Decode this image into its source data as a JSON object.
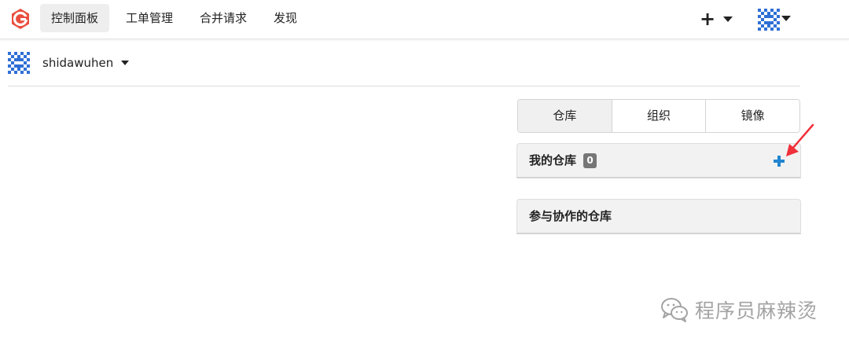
{
  "nav": {
    "items": [
      {
        "label": "控制面板",
        "active": true
      },
      {
        "label": "工单管理",
        "active": false
      },
      {
        "label": "合并请求",
        "active": false
      },
      {
        "label": "发现",
        "active": false
      }
    ],
    "create_icon": "plus-icon",
    "user_avatar": "identicon-avatar"
  },
  "context": {
    "username": "shidawuhen"
  },
  "tabs": [
    {
      "label": "仓库",
      "active": true
    },
    {
      "label": "组织",
      "active": false
    },
    {
      "label": "镜像",
      "active": false
    }
  ],
  "my_repos": {
    "title": "我的仓库",
    "count": "0",
    "add_icon": "plus-icon"
  },
  "collab_repos": {
    "title": "参与协作的仓库"
  },
  "annotation": {
    "arrow_color": "#f0303a"
  },
  "watermark": {
    "text": "程序员麻辣烫"
  },
  "colors": {
    "brand": "#e94e3c",
    "accent": "#2185d0",
    "avatar": "#2f6fd6"
  }
}
